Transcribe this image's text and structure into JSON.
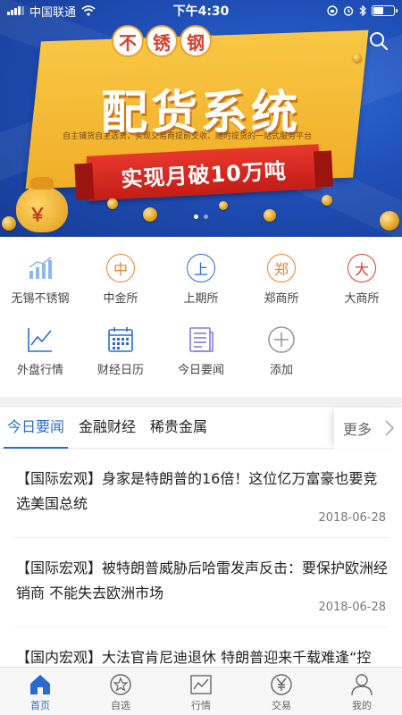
{
  "status_bar": {
    "carrier": "中国联通",
    "time": "下午4:30"
  },
  "banner": {
    "stamp_chars": [
      "不",
      "锈",
      "钢"
    ],
    "title": "配货系统",
    "subtitle": "自主铺货自主选货，实现交易商提前交收、随时提货的一站式服务平台",
    "ribbon": "实现月破10万吨",
    "bag_symbol": "￥"
  },
  "grid": {
    "row1": [
      {
        "label": "无锡不锈钢",
        "icon": "bar-chart-icon",
        "color": "#8fb8e8"
      },
      {
        "label": "中金所",
        "icon_char": "中",
        "color": "#e8822d"
      },
      {
        "label": "上期所",
        "icon_char": "上",
        "color": "#2a6bd1"
      },
      {
        "label": "郑商所",
        "icon_char": "郑",
        "color": "#e8822d"
      },
      {
        "label": "大商所",
        "icon_char": "大",
        "color": "#d8412b"
      }
    ],
    "row2": [
      {
        "label": "外盘行情",
        "icon": "line-chart-icon",
        "color": "#2a6bd1"
      },
      {
        "label": "财经日历",
        "icon": "calendar-icon",
        "color": "#2a6bd1"
      },
      {
        "label": "今日要闻",
        "icon": "news-icon",
        "color": "#8a7ad8"
      },
      {
        "label": "添加",
        "icon": "plus-icon",
        "color": "#999999"
      }
    ]
  },
  "tabs": {
    "items": [
      "今日要闻",
      "金融财经",
      "稀贵金属"
    ],
    "more": "更多"
  },
  "news": [
    {
      "title": "【国际宏观】身家是特朗普的16倍！这位亿万富豪也要竞选美国总统",
      "date": "2018-06-28"
    },
    {
      "title": "【国际宏观】被特朗普威胁后哈雷发声反击：要保护欧洲经销商 不能失去欧洲市场",
      "date": "2018-06-28"
    },
    {
      "title": "【国内宏观】大法官肯尼迪退休 特朗普迎来千载难逢“控",
      "date": ""
    }
  ],
  "tabbar": {
    "items": [
      "首页",
      "自选",
      "行情",
      "交易",
      "我的"
    ]
  },
  "colors": {
    "accent": "#2a6bd1",
    "banner_blue": "#1f4fb8",
    "banner_yellow": "#f1ae28",
    "ribbon_red": "#d8412b"
  }
}
